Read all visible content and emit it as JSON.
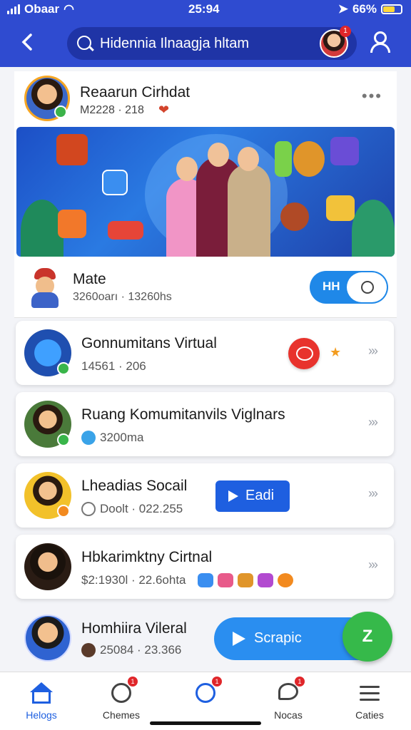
{
  "status_bar": {
    "carrier": "Obaar",
    "time": "25:94",
    "battery": "66%"
  },
  "header": {
    "search_text": "Hidennia Ilnaagja hltam",
    "avatar_badge": "1"
  },
  "post": {
    "name": "Reaarun Cirhdat",
    "meta": "M2228 · 218",
    "menu": "•••"
  },
  "mate": {
    "name": "Mate",
    "meta": "3260oarı · 13260hs",
    "toggle_label": "HH"
  },
  "communities": [
    {
      "title": "Gonnumitans Virtual",
      "sub": "14561 · 206"
    },
    {
      "title": "Ruang Komumitanvils Viglnars",
      "sub": "3200ma"
    },
    {
      "title": "Lheadias Socail",
      "sub": "Doolt · 022.255",
      "button": "Eadi"
    },
    {
      "title": "Hbkarimktny Cirtnal",
      "sub": "$2:1930l · 22.6ohta"
    },
    {
      "title": "Homhiira Vileral",
      "sub": "25084 · 23.366",
      "button": "Scrapic",
      "fab": "Z"
    }
  ],
  "nav": [
    {
      "label": "Helogs",
      "active": true
    },
    {
      "label": "Chemes",
      "badge": "1"
    },
    {
      "label": "",
      "badge": "1"
    },
    {
      "label": "Nocas",
      "badge": "1"
    },
    {
      "label": "Caties"
    }
  ],
  "colors": {
    "header": "#2f4bd0",
    "accent": "#1e5fe0",
    "danger": "#e8332d",
    "success": "#36b94a"
  }
}
